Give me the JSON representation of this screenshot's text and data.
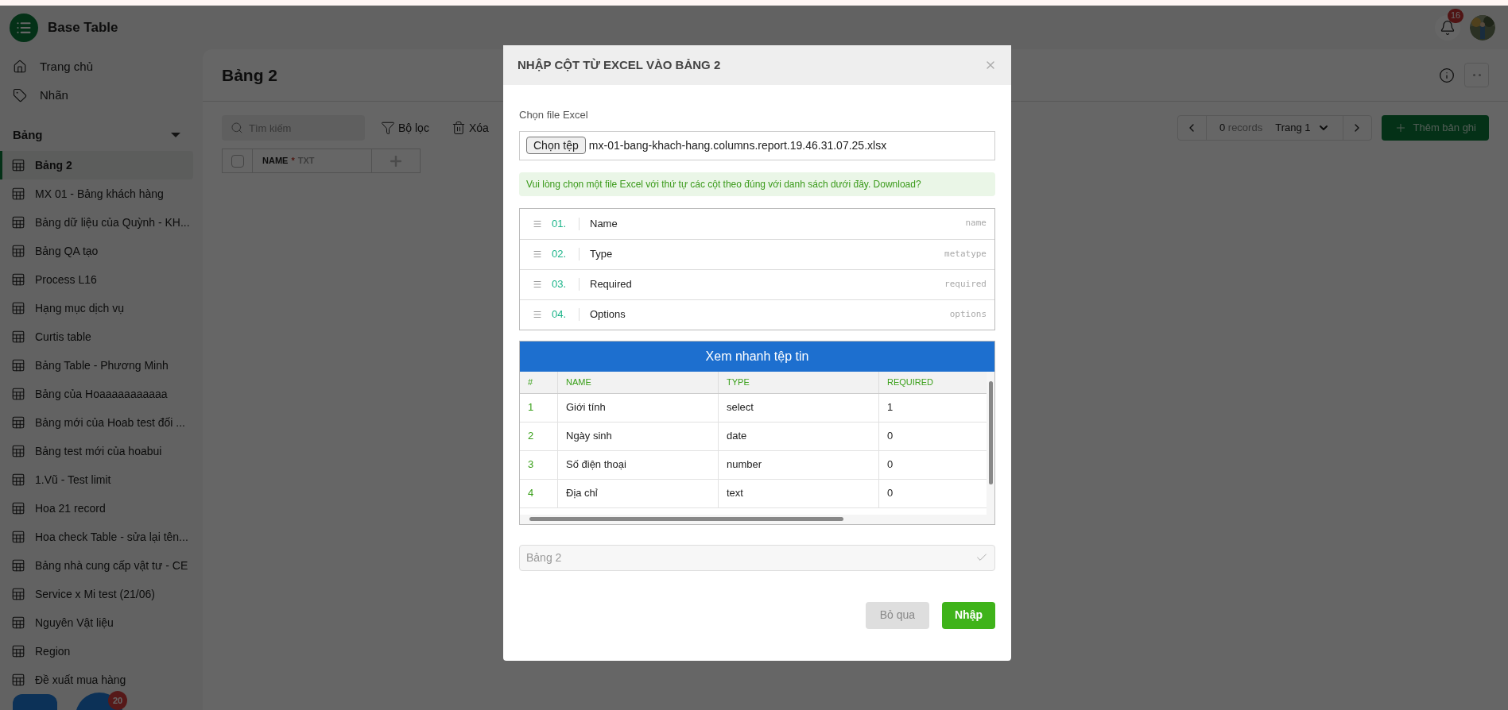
{
  "app": {
    "title": "Base Table",
    "notifications": "16"
  },
  "sidebar": {
    "nav": [
      {
        "label": "Trang chủ",
        "kind": "home"
      },
      {
        "label": "Nhãn",
        "kind": "tag"
      }
    ],
    "section": "Bảng",
    "tables": [
      {
        "label": "Bảng 2",
        "selected": true
      },
      {
        "label": "MX 01 - Bảng khách hàng",
        "selected": false
      },
      {
        "label": "Bảng dữ liệu của Quỳnh - KH...",
        "selected": false
      },
      {
        "label": "Bảng QA tạo",
        "selected": false
      },
      {
        "label": "Process L16",
        "selected": false
      },
      {
        "label": "Hạng mục dịch vụ",
        "selected": false
      },
      {
        "label": "Curtis table",
        "selected": false
      },
      {
        "label": "Bảng Table - Phương Minh",
        "selected": false
      },
      {
        "label": "Bảng của Hoaaaaaaaaaaa",
        "selected": false
      },
      {
        "label": "Bảng mới của Hoab test đối ...",
        "selected": false
      },
      {
        "label": "Bảng test mới của hoabui",
        "selected": false
      },
      {
        "label": "1.Vũ - Test limit",
        "selected": false
      },
      {
        "label": "Hoa 21 record",
        "selected": false
      },
      {
        "label": "Hoa check Table - sửa lại tên...",
        "selected": false
      },
      {
        "label": "Bảng nhà cung cấp vật tư - CE",
        "selected": false
      },
      {
        "label": "Service x Mi test (21/06)",
        "selected": false
      },
      {
        "label": "Nguyên Vật liệu",
        "selected": false
      },
      {
        "label": "Region",
        "selected": false
      },
      {
        "label": "Đề xuất mua hàng",
        "selected": false
      }
    ],
    "floating_badge": "20"
  },
  "page": {
    "title": "Bảng 2",
    "search_placeholder": "Tìm kiếm",
    "filter": "Bộ lọc",
    "delete": "Xóa",
    "grid": {
      "checked": false,
      "column": "NAME",
      "required_mark": "*",
      "type": "TXT"
    },
    "pager": {
      "count": "0",
      "unit": "records",
      "page": "Trang 1"
    },
    "add_button": "Thêm bản ghi"
  },
  "dialog": {
    "title": "NHẬP CỘT TỪ EXCEL VÀO BẢNG 2",
    "file_label": "Chọn file Excel",
    "file_button": "Chọn tệp",
    "file_name": "mx-01-bang-khach-hang.columns.report.19.46.31.07.25.xlsx",
    "notice": "Vui lòng chọn một file Excel với thứ tự các cột theo đúng với danh sách dưới đây. Download?",
    "columns": [
      {
        "index": "01.",
        "label": "Name",
        "key": "name"
      },
      {
        "index": "02.",
        "label": "Type",
        "key": "metatype"
      },
      {
        "index": "03.",
        "label": "Required",
        "key": "required"
      },
      {
        "index": "04.",
        "label": "Options",
        "key": "options"
      }
    ],
    "preview": {
      "title": "Xem nhanh tệp tin",
      "headers": [
        "#",
        "NAME",
        "TYPE",
        "REQUIRED"
      ],
      "rows": [
        [
          "1",
          "Giới tính",
          "select",
          "1"
        ],
        [
          "2",
          "Ngày sinh",
          "date",
          "0"
        ],
        [
          "3",
          "Số điện thoại",
          "number",
          "0"
        ],
        [
          "4",
          "Địa chỉ",
          "text",
          "0"
        ]
      ]
    },
    "target": "Bảng 2",
    "cancel": "Bỏ qua",
    "submit": "Nhập"
  }
}
